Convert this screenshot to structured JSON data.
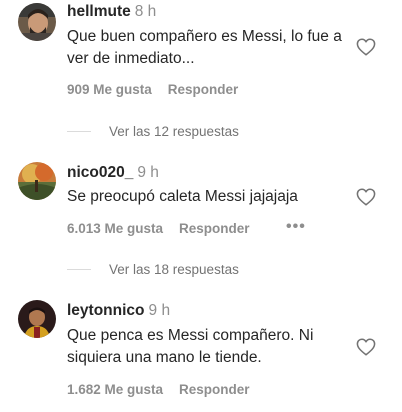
{
  "colors": {
    "text": "#262626",
    "muted": "#8e8e8e",
    "divider": "#dbdbdb"
  },
  "icons": {
    "like": "heart-outline-icon",
    "more": "ellipsis-icon"
  },
  "comments": [
    {
      "username": "hellmute",
      "time": "8 h",
      "text": "Que buen compañero es Messi, lo fue a ver de inmediato...",
      "likes": "909 Me gusta",
      "reply": "Responder",
      "view_replies": "Ver las 12 respuestas"
    },
    {
      "username": "nico020_",
      "time": "9 h",
      "text": "Se preocupó caleta Messi jajajaja",
      "likes": "6.013 Me gusta",
      "reply": "Responder",
      "more": "•••",
      "view_replies": "Ver las 18 respuestas"
    },
    {
      "username": "leytonnico",
      "time": "9 h",
      "text": "Que penca es Messi compañero. Ni siquiera una mano le tiende.",
      "likes": "1.682 Me gusta",
      "reply": "Responder"
    }
  ]
}
